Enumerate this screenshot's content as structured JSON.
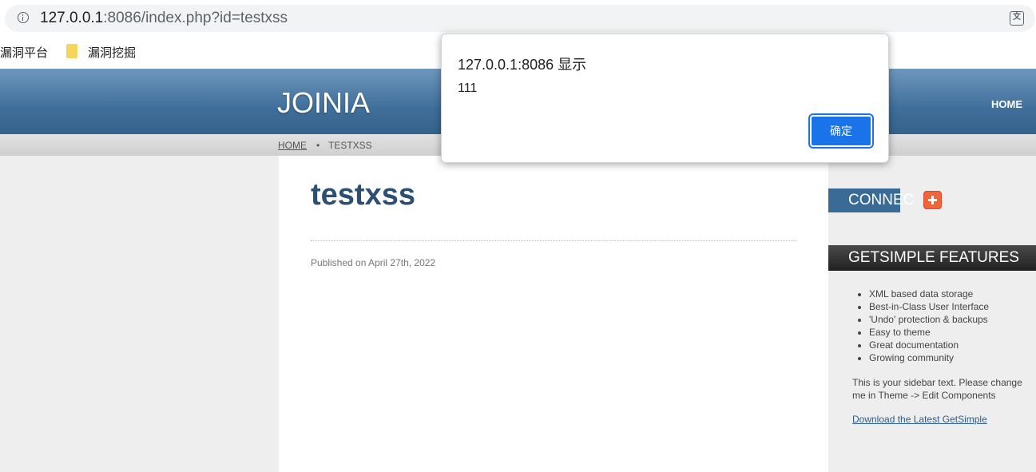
{
  "browser": {
    "url_host": "127.0.0.1",
    "url_rest": ":8086/index.php?id=testxss",
    "bookmarks": [
      "漏洞平台",
      "漏洞挖掘"
    ]
  },
  "site": {
    "logo": "JOINIA",
    "nav": [
      "HOME"
    ],
    "breadcrumb": {
      "home": "HOME",
      "separator": "•",
      "current": "TESTXSS"
    }
  },
  "main": {
    "title": "testxss",
    "published": "Published on April 27th, 2022"
  },
  "sidebar": {
    "connect_title": "CONNEC",
    "features_title": "GETSIMPLE FEATURES",
    "features": [
      "XML based data storage",
      "Best-in-Class User Interface",
      "'Undo' protection & backups",
      "Easy to theme",
      "Great documentation",
      "Growing community"
    ],
    "text": "This is your sidebar text. Please change me in Theme -> Edit Components",
    "link": "Download the Latest GetSimple"
  },
  "dialog": {
    "title": "127.0.0.1:8086 显示",
    "message": "111",
    "ok_label": "确定"
  },
  "colors": {
    "header_blue": "#3f6f9b",
    "title_blue": "#2c4f73",
    "dialog_button": "#1a73e8",
    "plus_orange": "#f0643c"
  }
}
